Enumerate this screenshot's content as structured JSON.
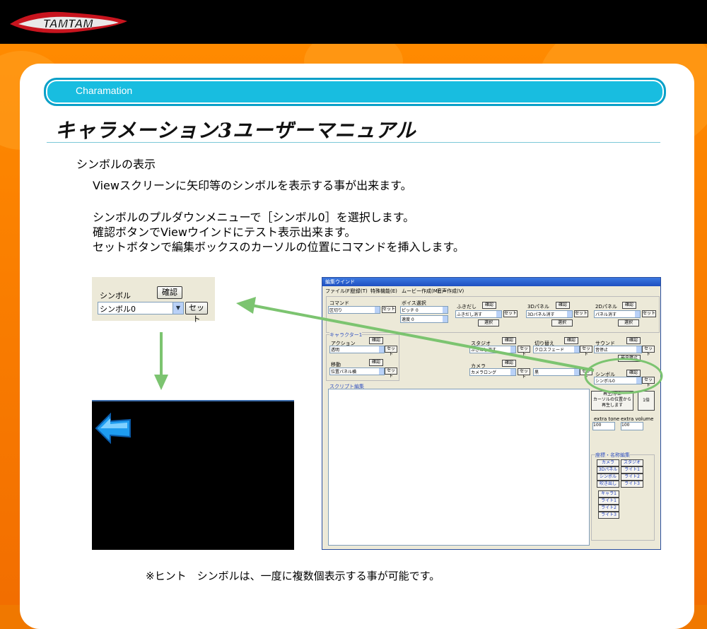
{
  "header": {
    "logo_text": "TAMTAM"
  },
  "banner": {
    "label": "Charamation"
  },
  "page_title": "キャラメーション3ユーザーマニュアル",
  "section_title": "シンボルの表示",
  "paragraphs": [
    "Viewスクリーンに矢印等のシンボルを表示する事が出来ます。",
    "シンボルのプルダウンメニューで［シンボル0］を選択します。",
    "確認ボタンでViewウインドにテスト表示出来ます。",
    "セットボタンで編集ボックスのカーソルの位置にコマンドを挿入します。"
  ],
  "widget": {
    "label": "シンボル",
    "confirm_label": "確認",
    "select_value": "シンボル0",
    "set_label": "セット"
  },
  "editor_window": {
    "title": "編集ウインド",
    "menu": [
      "ファイル(F)",
      "登録(T)",
      "特殊機能(E)",
      "ムービー作成(M)",
      "音声作成(V)"
    ],
    "command_label": "コマンド",
    "command_value": "区切り",
    "voice_label": "ボイス選択",
    "pitch_value": "ピッチ 0",
    "speed_value": "速度 0",
    "fukidashi_label": "ふきだし",
    "fukidashi_value": "ふきだし消す",
    "panel3d_label": "3Dパネル",
    "panel3d_value": "3Dパネル消す",
    "panel2d_label": "2Dパネル",
    "panel2d_value": "パネル消す",
    "select_label": "選択",
    "confirm_label": "確認",
    "set_label": "セット",
    "character_label": "キャラクター1",
    "action_label": "アクション",
    "action_value": "透明",
    "move_label": "移動",
    "move_value": "位置パネル横",
    "studio_label": "スタジオ",
    "studio_value": "ふきだし消す",
    "switch_label": "切り替え",
    "switch_value": "クロスフェード",
    "sound_label": "サウンド",
    "sound_value": "音停止",
    "stop_all_label": "最全停止",
    "camera_label": "カメラ",
    "camera_value": "カメラロング",
    "color_label": "色",
    "color_value": "黒",
    "symbol_label": "シンボル",
    "symbol_value": "シンボル0",
    "script_label": "スクリプト編集",
    "play_label_1": "再生/停止",
    "play_label_2": "カーソルの位置から",
    "play_label_3": "再生します",
    "speed_button": "1倍",
    "extra_tone_label": "extra tone",
    "extra_tone_value": "100",
    "extra_volume_label": "extra volume",
    "extra_volume_value": "100",
    "coord_label": "座標・名称編集",
    "coord_buttons": [
      "カメラ",
      "スタジオ",
      "3Dパネル",
      "ライト1",
      "シンボル",
      "ライト2",
      "吹き出し",
      "ライト3"
    ],
    "coord_buttons2": [
      "キャラ1",
      "ライト1",
      "ライト2",
      "ライト3"
    ]
  },
  "hint": "※ヒント　シンボルは、一度に複数個表示する事が可能です。"
}
